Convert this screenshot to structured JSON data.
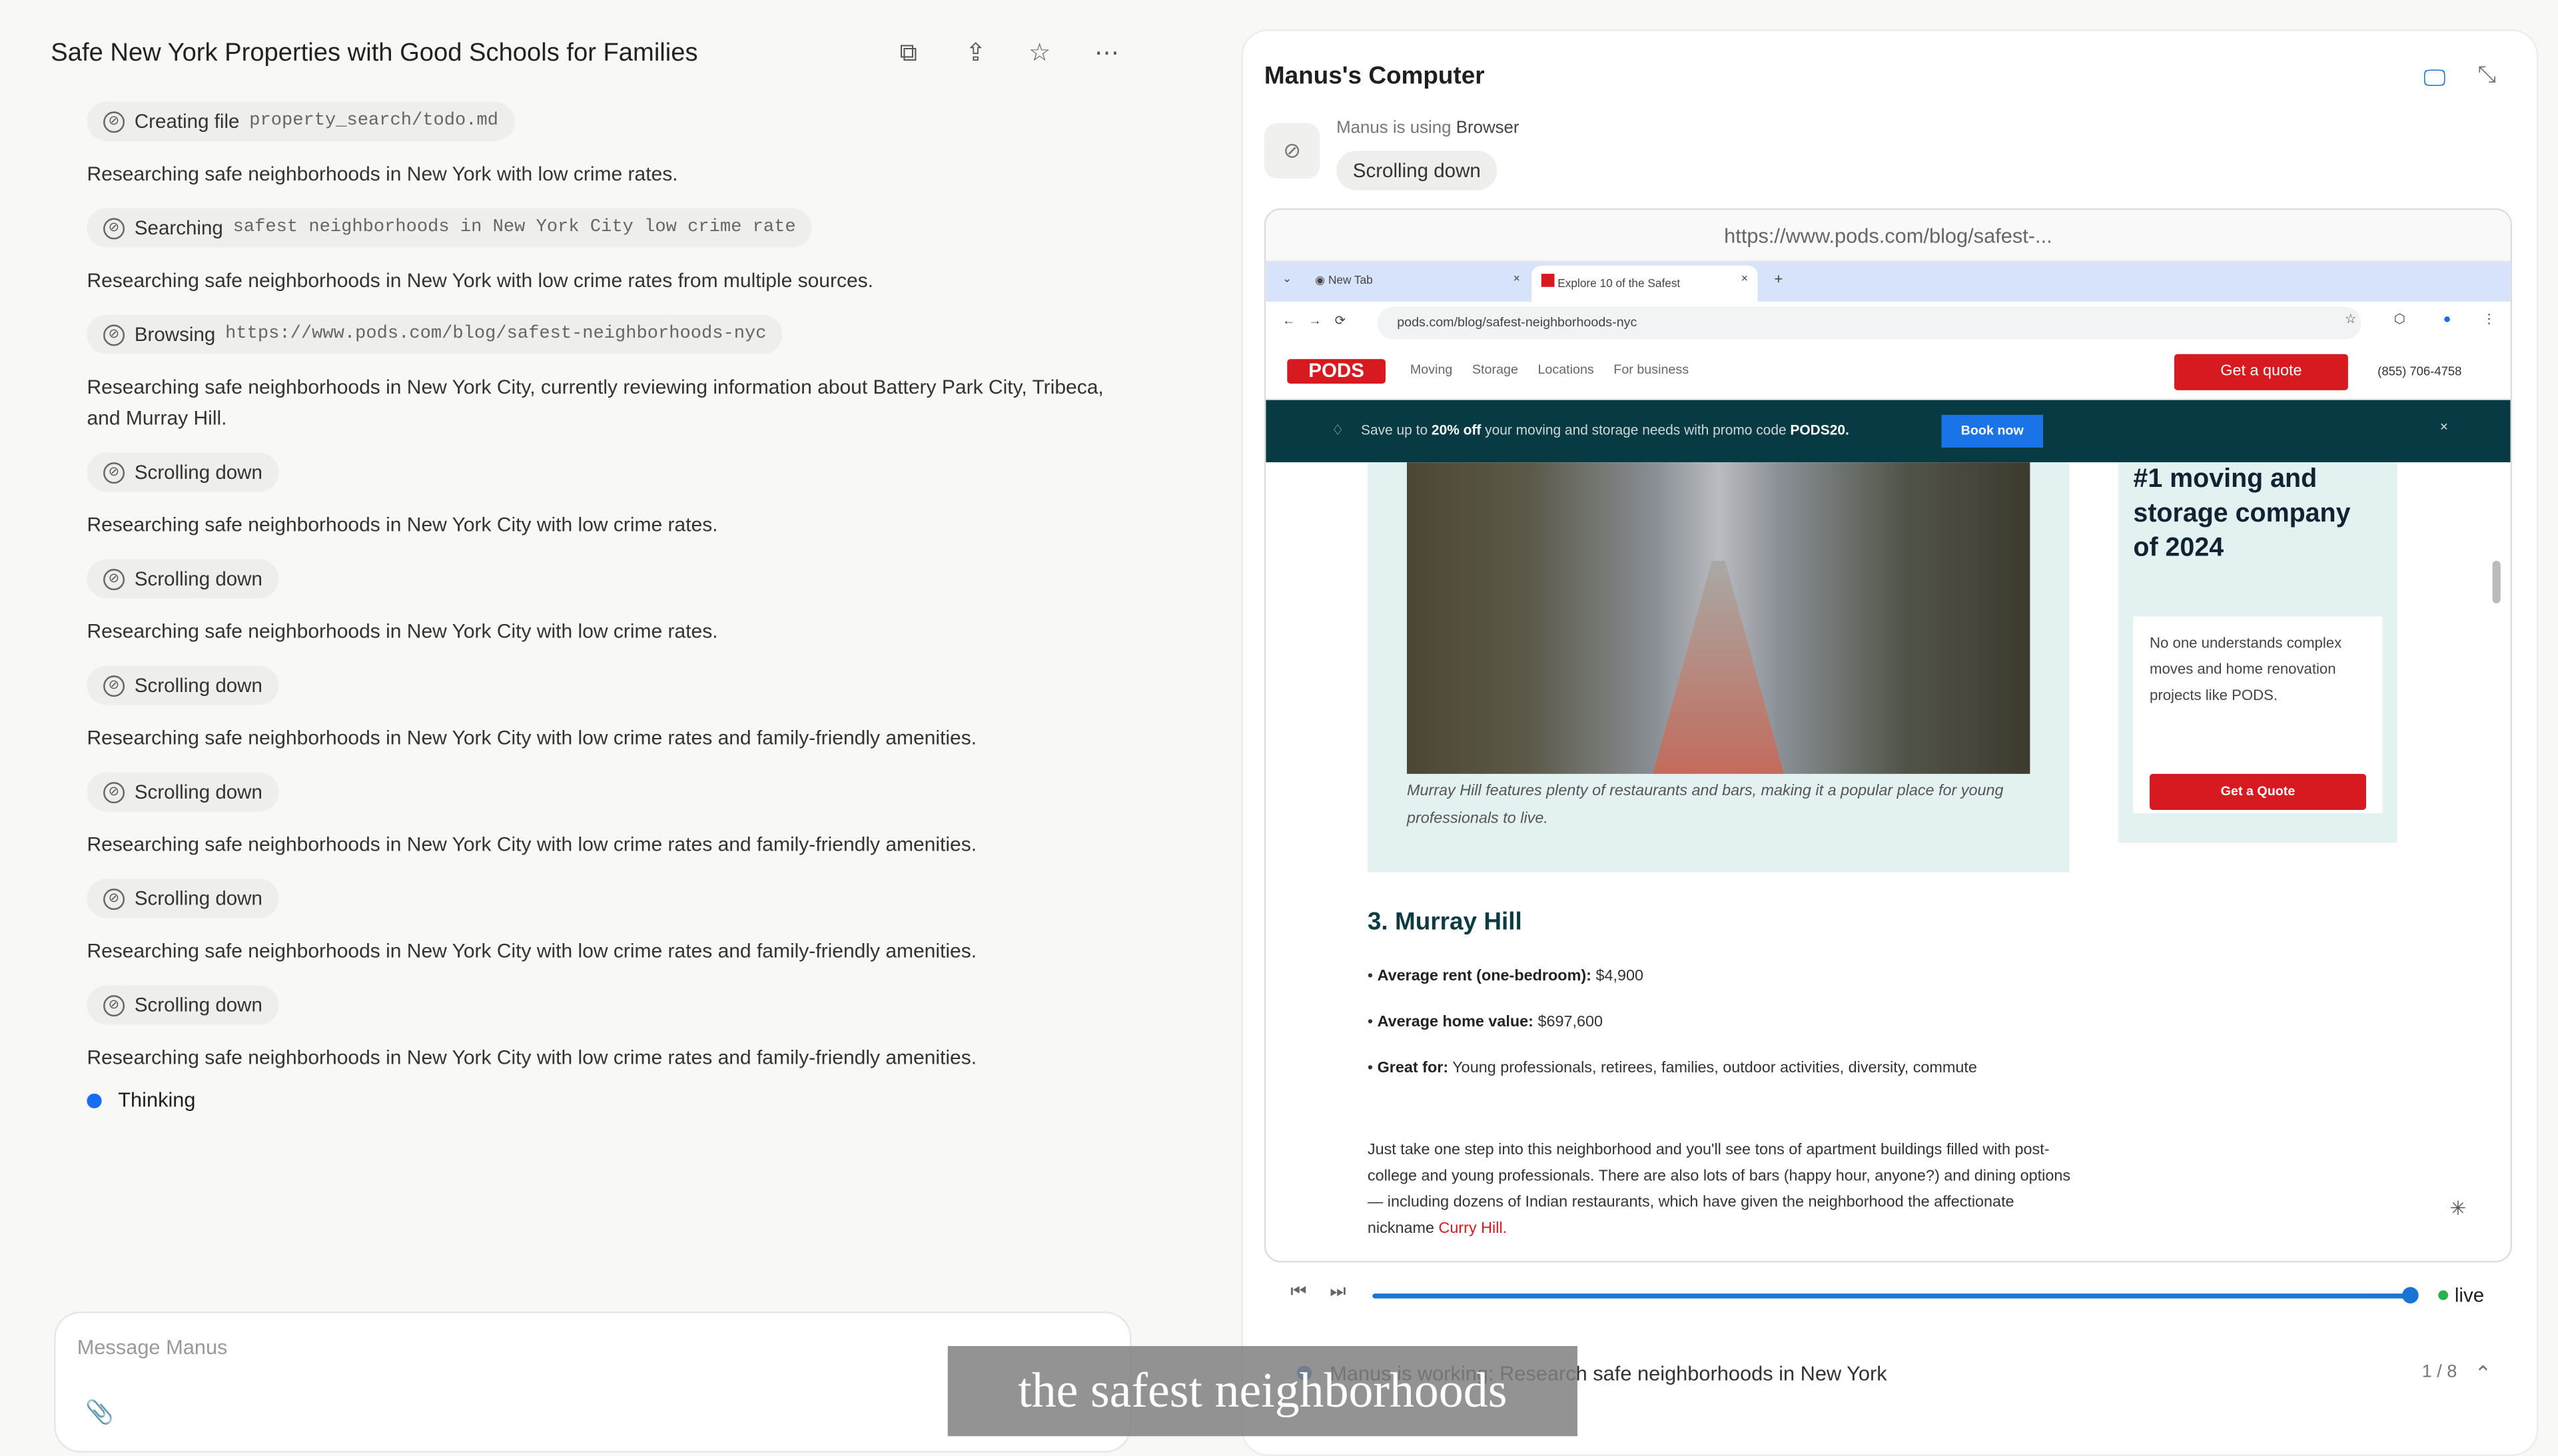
{
  "header": {
    "title": "Safe New York Properties with Good Schools for Families",
    "icons": [
      "file-copy-icon",
      "share-icon",
      "star-icon",
      "more-icon"
    ]
  },
  "messages": [
    {
      "type": "chip",
      "action": "Creating file",
      "arg": "property_search/todo.md"
    },
    {
      "type": "text",
      "text": "Researching safe neighborhoods in New York with low crime rates."
    },
    {
      "type": "chip",
      "action": "Searching",
      "arg": "safest neighborhoods in New York City low crime rate"
    },
    {
      "type": "text",
      "text": "Researching safe neighborhoods in New York with low crime rates from multiple sources."
    },
    {
      "type": "chip",
      "action": "Browsing",
      "arg": "https://www.pods.com/blog/safest-neighborhoods-nyc"
    },
    {
      "type": "text",
      "text": "Researching safe neighborhoods in New York City, currently reviewing information about Battery Park City, Tribeca, and Murray Hill."
    },
    {
      "type": "chip",
      "action": "Scrolling down",
      "arg": ""
    },
    {
      "type": "text",
      "text": "Researching safe neighborhoods in New York City with low crime rates."
    },
    {
      "type": "chip",
      "action": "Scrolling down",
      "arg": ""
    },
    {
      "type": "text",
      "text": "Researching safe neighborhoods in New York City with low crime rates."
    },
    {
      "type": "chip",
      "action": "Scrolling down",
      "arg": ""
    },
    {
      "type": "text",
      "text": "Researching safe neighborhoods in New York City with low crime rates and family-friendly amenities."
    },
    {
      "type": "chip",
      "action": "Scrolling down",
      "arg": ""
    },
    {
      "type": "text",
      "text": "Researching safe neighborhoods in New York City with low crime rates and family-friendly amenities."
    },
    {
      "type": "chip",
      "action": "Scrolling down",
      "arg": ""
    },
    {
      "type": "text",
      "text": "Researching safe neighborhoods in New York City with low crime rates and family-friendly amenities."
    },
    {
      "type": "chip",
      "action": "Scrolling down",
      "arg": ""
    },
    {
      "type": "text",
      "text": "Researching safe neighborhoods in New York City with low crime rates and family-friendly amenities."
    }
  ],
  "thinking": "Thinking",
  "input": {
    "placeholder": "Message Manus"
  },
  "computer": {
    "title": "Manus's Computer",
    "using_prefix": "Manus is using",
    "using_app": "Browser",
    "action": "Scrolling down",
    "url": "https://www.pods.com/blog/safest-...",
    "browser": {
      "tabs": [
        "New Tab",
        "Explore 10 of the Safest"
      ],
      "address": "pods.com/blog/safest-neighborhoods-nyc",
      "logo": "PODS",
      "nav": [
        "Moving",
        "Storage",
        "Locations",
        "For business"
      ],
      "quote_btn": "Get a quote",
      "phone": "(855) 706-4758",
      "promo_pre": "Save up to ",
      "promo_bold": "20% off",
      "promo_mid": " your moving and storage needs with promo code ",
      "promo_code": "PODS20.",
      "book_btn": "Book now",
      "caption": "Murray Hill features plenty of restaurants and bars, making it a popular place for young professionals to live.",
      "side_title": "#1 moving and storage company of 2024",
      "side_text": "No one understands complex moves and home renovation projects like PODS.",
      "side_btn": "Get a Quote",
      "heading": "3. Murray Hill",
      "bullets": [
        {
          "label": "Average rent (one-bedroom):",
          "value": " $4,900"
        },
        {
          "label": "Average home value:",
          "value": " $697,600"
        },
        {
          "label": "Great for:",
          "value": " Young professionals, retirees, families, outdoor activities, diversity, commute"
        }
      ],
      "para": "Just take one step into this neighborhood and you'll see tons of apartment buildings filled with post-college and young professionals. There are also lots of bars (happy hour, anyone?) and dining options — including dozens of Indian restaurants, which have given the neighborhood the affectionate nickname ",
      "para_link": "Curry Hill."
    },
    "playback": {
      "progress": 1.0,
      "live": "live"
    },
    "status": {
      "text": "Manus is working: Research safe neighborhoods in New York",
      "step": "1 / 8"
    }
  },
  "subtitle": "the safest neighborhoods",
  "colors": {
    "accent": "#1a6cf0",
    "pods_red": "#d71920",
    "promo_bg": "#073a42"
  }
}
